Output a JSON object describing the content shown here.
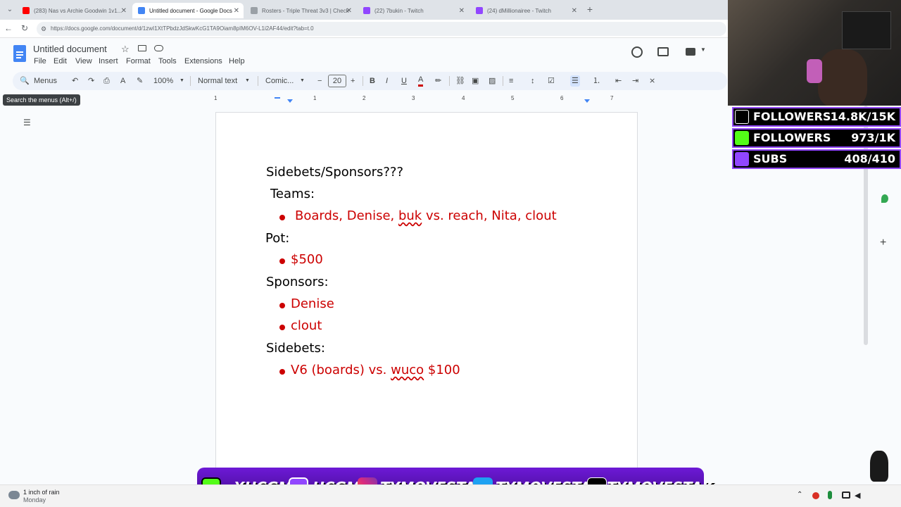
{
  "browser": {
    "tabs": [
      {
        "title": "(283) Nas vs Archie Goodwin 1v1...",
        "active": false
      },
      {
        "title": "Untitled document - Google Docs",
        "active": true
      },
      {
        "title": "Rosters - Triple Threat 3v3 | Check",
        "active": false
      },
      {
        "title": "(22) 7bukin - Twitch",
        "active": false
      },
      {
        "title": "(24) dMillionairee - Twitch",
        "active": false
      }
    ],
    "url": "https://docs.google.com/document/d/1zwI1XtTPbdzJdSkwKcG1TA9Oiam8pIM6OV-L1i2AF44/edit?tab=t.0"
  },
  "docs": {
    "title": "Untitled document",
    "menu": [
      "File",
      "Edit",
      "View",
      "Insert",
      "Format",
      "Tools",
      "Extensions",
      "Help"
    ],
    "toolbar": {
      "search_menus": "Menus",
      "zoom": "100%",
      "style": "Normal text",
      "font": "Comic...",
      "font_size": "20"
    },
    "tooltip": "Search the menus (Alt+/)",
    "ruler_numbers": [
      "1",
      "1",
      "2",
      "3",
      "4",
      "5",
      "6",
      "7"
    ]
  },
  "document": {
    "heading": "Sidebets/Sponsors???",
    "teams_label": "Teams:",
    "teams_item_parts": [
      "Boards, Denise, ",
      "buk",
      " vs. reach, Nita, clout"
    ],
    "pot_label": "Pot:",
    "pot_item": "$500",
    "sponsors_label": "Sponsors:",
    "sponsors_items": [
      "Denise",
      "clout"
    ],
    "sidebets_label": "Sidebets:",
    "sidebets_item_parts": [
      "V6 (boards) vs. ",
      "wuco",
      " $100"
    ]
  },
  "overlay": {
    "stats": [
      {
        "label": "FOLLOWERS",
        "value": "14.8K/15K",
        "icon": "tiktok-icon",
        "color": "#000000"
      },
      {
        "label": "FOLLOWERS",
        "value": "973/1K",
        "icon": "kick-icon",
        "color": "#53fc18"
      },
      {
        "label": "SUBS",
        "value": "408/410",
        "icon": "twitch-icon",
        "color": "#9146ff"
      }
    ],
    "socials": [
      {
        "icon": "kick-icon",
        "handle": "XHCGM"
      },
      {
        "icon": "twitch-icon",
        "handle": "HCGM"
      },
      {
        "icon": "instagram-icon",
        "handle": "TYMOVESTAK"
      },
      {
        "icon": "twitter-icon",
        "handle": "TYMOVESTAK"
      },
      {
        "icon": "tiktok-icon",
        "handle": "TYMOVESTAK"
      }
    ]
  },
  "taskbar": {
    "weather_title": "1 inch of rain",
    "weather_sub": "Monday"
  },
  "colors": {
    "accent_red": "#cc0000",
    "purple": "#9146ff",
    "kick_green": "#53fc18"
  }
}
